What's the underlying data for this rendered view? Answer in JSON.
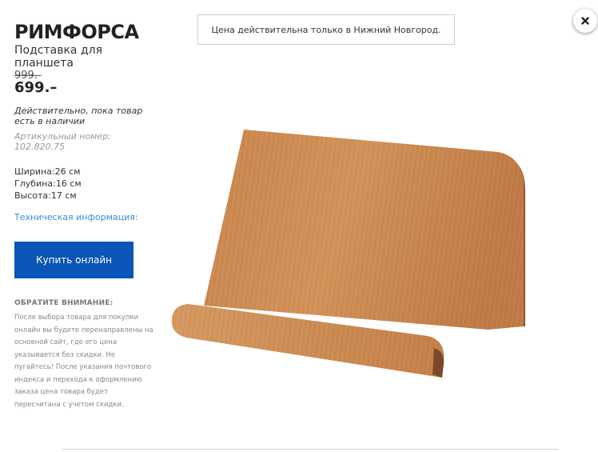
{
  "product": {
    "name": "РИМФОРСА",
    "description": "Подставка для планшета",
    "old_price": "999.-",
    "price": "699.–",
    "availability": "Действительно, пока товар есть в наличии",
    "article": "Артикульный номер: 102.820.75",
    "dimensions": {
      "width": "Ширина:26 см",
      "depth": "Глубина:16 см",
      "height": "Высота:17 см"
    },
    "tech_info_link": "Техническая информация:",
    "buy_button": "Купить онлайн"
  },
  "notice": {
    "heading": "ОБРАТИТЕ ВНИМАНИЕ:",
    "text": "После выбора товара для покупки онлайн вы будете перенаправлены на основной сайт, где его цена указывается без скидки. Не пугайтесь! После указания почтового индекса и перехода к оформлению заказа цена товара будет пересчитана с учетом скидки."
  },
  "city_notice": "Цена действительна только в Нижний Новгород.",
  "icons": {
    "close": "close-icon"
  },
  "colors": {
    "button_bg": "#0a55b5",
    "link": "#3c8ad1",
    "wood": "#c9864f"
  }
}
